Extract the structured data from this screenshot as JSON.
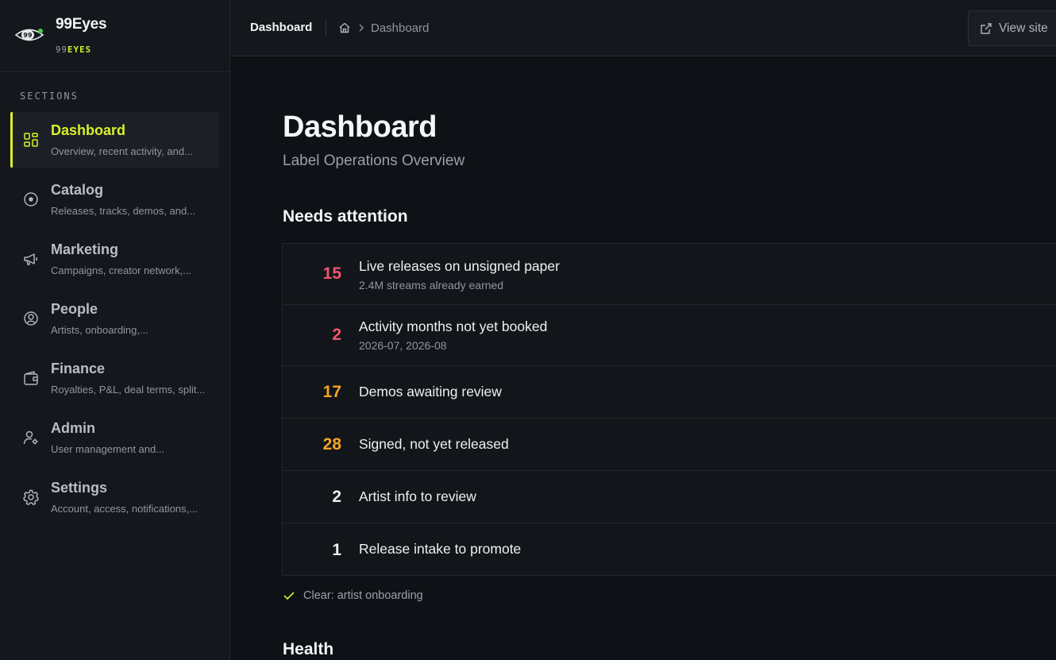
{
  "brand": {
    "name": "99Eyes",
    "sub_prefix": "99",
    "sub_highlight": "EYES",
    "logo_text": "99"
  },
  "sidebar": {
    "section_label": "SECTIONS",
    "items": [
      {
        "title": "Dashboard",
        "desc": "Overview, recent activity, and...",
        "icon": "dashboard-grid-icon",
        "active": true
      },
      {
        "title": "Catalog",
        "desc": "Releases, tracks, demos, and...",
        "icon": "disc-icon"
      },
      {
        "title": "Marketing",
        "desc": "Campaigns, creator network,...",
        "icon": "megaphone-icon"
      },
      {
        "title": "People",
        "desc": "Artists, onboarding,...",
        "icon": "user-circle-icon"
      },
      {
        "title": "Finance",
        "desc": "Royalties, P&L, deal terms, split...",
        "icon": "wallet-icon"
      },
      {
        "title": "Admin",
        "desc": "User management and...",
        "icon": "user-gear-icon"
      },
      {
        "title": "Settings",
        "desc": "Account, access, notifications,...",
        "icon": "gear-icon"
      }
    ]
  },
  "topbar": {
    "title": "Dashboard",
    "breadcrumb_current": "Dashboard",
    "view_site_label": "View site"
  },
  "main": {
    "title": "Dashboard",
    "subtitle": "Label Operations Overview",
    "attention_heading": "Needs attention",
    "attention_items": [
      {
        "count": "15",
        "label": "Live releases on unsigned paper",
        "sub": "2.4M streams already earned",
        "color": "#f0566f"
      },
      {
        "count": "2",
        "label": "Activity months not yet booked",
        "sub": "2026-07, 2026-08",
        "color": "#f0566f"
      },
      {
        "count": "17",
        "label": "Demos awaiting review",
        "sub": "",
        "color": "#f5a524"
      },
      {
        "count": "28",
        "label": "Signed, not yet released",
        "sub": "",
        "color": "#f5a524"
      },
      {
        "count": "2",
        "label": "Artist info to review",
        "sub": "",
        "color": "#eef0f2"
      },
      {
        "count": "1",
        "label": "Release intake to promote",
        "sub": "",
        "color": "#eef0f2"
      }
    ],
    "clear_text": "Clear: artist onboarding",
    "health_heading": "Health"
  },
  "colors": {
    "accent": "#d9f02a",
    "danger": "#f0566f",
    "warning": "#f5a524"
  }
}
